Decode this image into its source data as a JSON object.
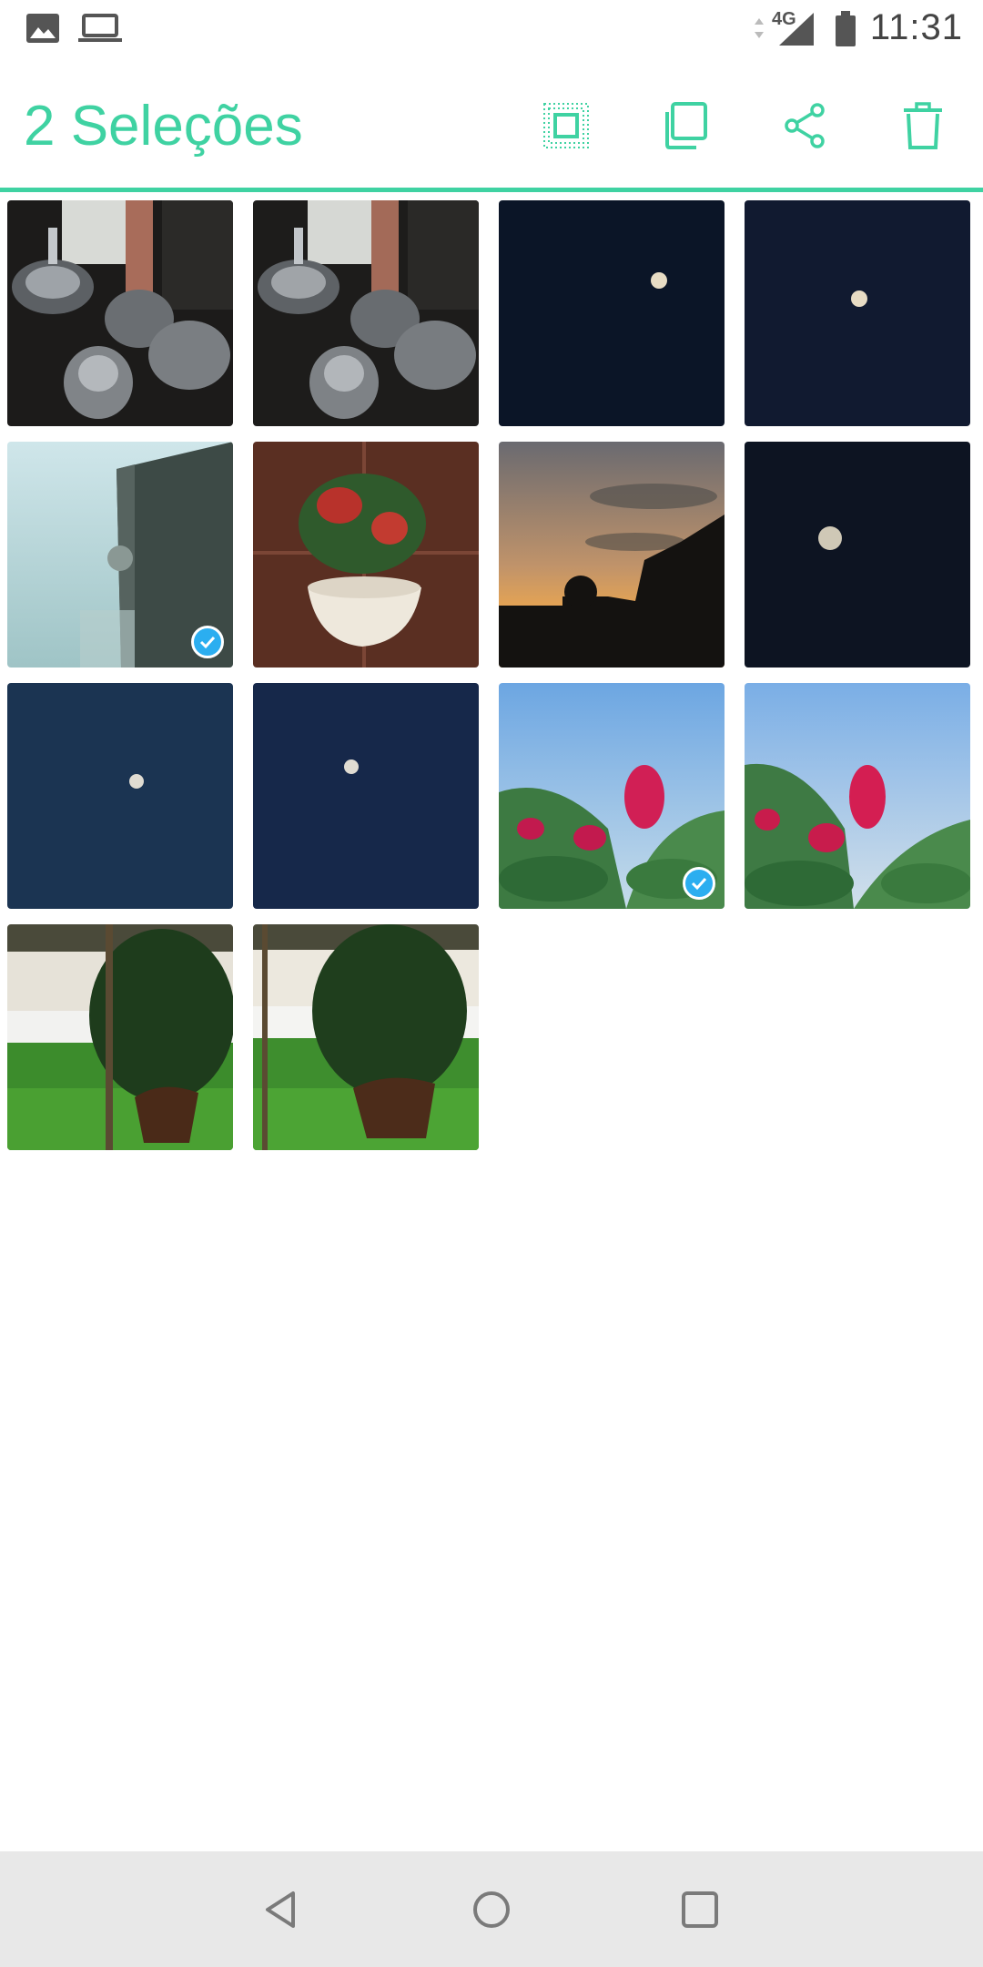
{
  "status_bar": {
    "network_label": "4G",
    "time": "11:31",
    "icons": [
      "image-icon",
      "laptop-icon",
      "data-arrows-icon",
      "signal-icon",
      "battery-icon"
    ]
  },
  "action_bar": {
    "title": "2 Seleções",
    "accent_color": "#3fd2a2",
    "actions": [
      {
        "name": "select-all-icon"
      },
      {
        "name": "copy-icon"
      },
      {
        "name": "share-icon"
      },
      {
        "name": "trash-icon"
      }
    ]
  },
  "grid": {
    "columns": 4,
    "selected_count": 2,
    "badge_color": "#2baef0",
    "photos": [
      {
        "subject": "glassware",
        "selected": false
      },
      {
        "subject": "glassware",
        "selected": false
      },
      {
        "subject": "moon",
        "selected": false
      },
      {
        "subject": "moon",
        "selected": false
      },
      {
        "subject": "wall-camera",
        "selected": true
      },
      {
        "subject": "potted-plant",
        "selected": false
      },
      {
        "subject": "sunset",
        "selected": false
      },
      {
        "subject": "moon",
        "selected": false
      },
      {
        "subject": "moon",
        "selected": false
      },
      {
        "subject": "moon",
        "selected": false
      },
      {
        "subject": "flowers",
        "selected": true
      },
      {
        "subject": "flowers",
        "selected": false
      },
      {
        "subject": "garden",
        "selected": false
      },
      {
        "subject": "garden",
        "selected": false
      }
    ]
  },
  "nav_bar": {
    "buttons": [
      "back-icon",
      "home-icon",
      "recents-icon"
    ]
  }
}
